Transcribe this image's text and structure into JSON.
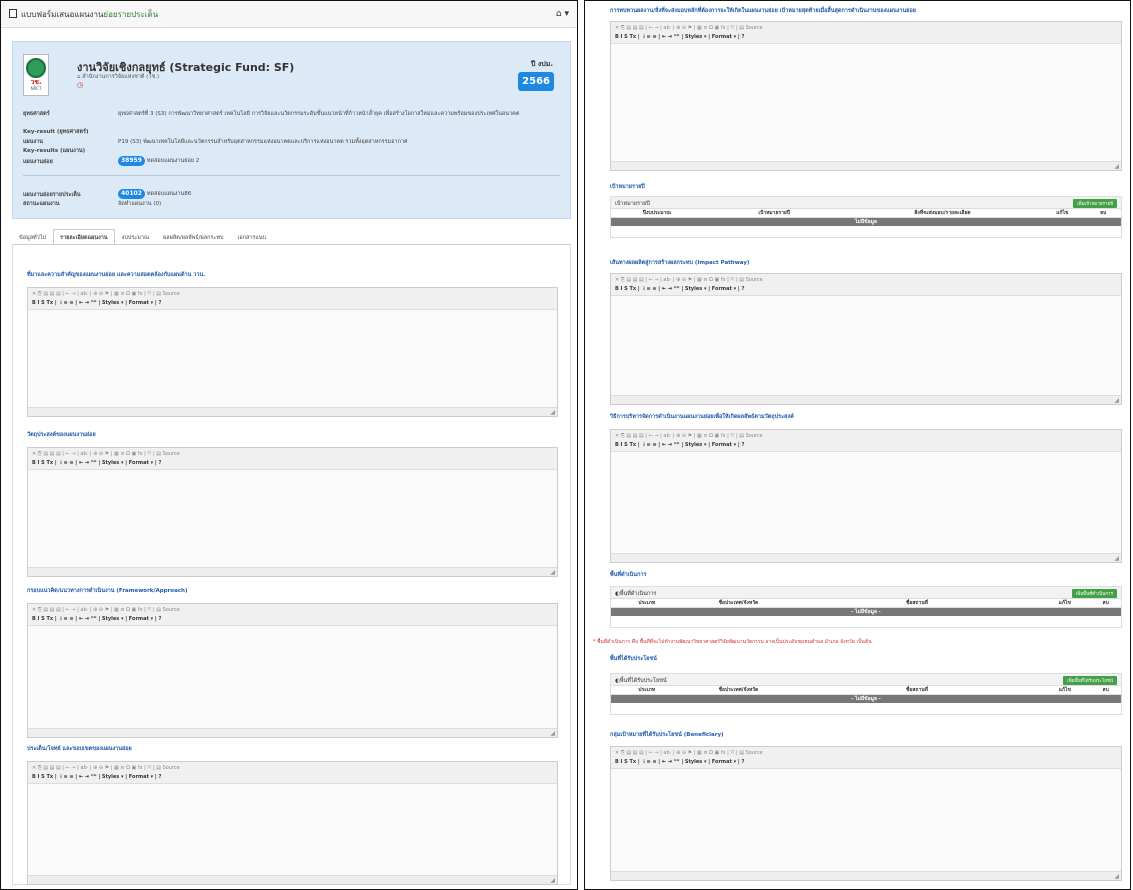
{
  "topbar": {
    "title_prefix": "แบบฟอร์มเสนอแผนงาน",
    "title_link": "ย่อยรายประเด็น",
    "home_icon": "home-icon"
  },
  "card": {
    "title": "งานวิจัยเชิงกลยุทธ์ (Strategic Fund: SF)",
    "agency": "สำนักงานการวิจัยแห่งชาติ (วช.)",
    "logo_text": "วช.",
    "logo_sub": "NRCT",
    "year_label": "ปี งปม.",
    "year": "2566",
    "rows": [
      {
        "label": "ยุทธศาสตร์",
        "value": "ยุทธศาสตร์ที่ 3 (S3) การพัฒนาวิทยาศาสตร์ เทคโนโลยี การวิจัยและนวัตกรรมระดับขั้นแนวหน้าที่ก้าวหน้าล้ำยุค เพื่อสร้างโอกาสใหม่และความพร้อมของประเทศในอนาคต"
      },
      {
        "label": "Key-result (ยุทธศาสตร์)",
        "value": ""
      },
      {
        "label": "แผนงาน",
        "value": "P19 (S3) พัฒนาเทคโนโลยีและนวัตกรรมสำหรับอุตสาหกรรมแห่งอนาคตและบริการแห่งอนาคต รวมทั้งอุตสาหกรรมอากาศ"
      },
      {
        "label": "Key-results (แผนงาน)",
        "value": ""
      },
      {
        "label": "แผนงานย่อย",
        "pill": "38959",
        "value": "ทดสอบแผนงานย่อย 2"
      },
      {
        "label": "แผนงานย่อยรายประเด็น",
        "pill": "40102",
        "value": "ทดสอบแผนงาน86"
      },
      {
        "label": "สถานะแผนงาน",
        "value": "จัดทำแผนงาน (0)"
      }
    ]
  },
  "tabs": [
    "ข้อมูลทั่วไป",
    "รายละเอียดแผนงาน",
    "งบประมาณ",
    "ผลผลิต/ผลลัพธ์/ผลกระทบ",
    "เอกสารแนบ"
  ],
  "editor_toolbar": {
    "row1": "✕ ⎘ ▤ ▤ ▤ | ← → | ab· | ⊕ ⊖ ⚑ | ▦ ≡ Ω ▣ fx | ⤧ | ▤ Source",
    "row2": "B  I  S  Tx | ⋮≡ ≡ | ⇤ ⇥ ❞❞ | Styles  ▾ | Format  ▾ | ?"
  },
  "left_sections": [
    "ที่มาและความสำคัญของแผนงานย่อย และความสอดคล้องกับแผนด้าน ววน.",
    "วัตถุประสงค์ของแผนงานย่อย",
    "กรอบแนวคิด/แนวทางการดำเนินงาน (Framework/Approach)",
    "ประเด็น/โจทย์ และขอบเขตของแผนงานย่อย"
  ],
  "right": {
    "sec_top": "การทบทวนผลงาน/สิ่งที่จะส่งมอบหลักที่ต้องการจะให้เกิดในแผนงานย่อย เป้าหมายสุดท้ายเมื่อสิ้นสุดการดำเนินงานของแผนงานย่อย",
    "sec_target": "เป้าหมายรายปี",
    "target_table": {
      "title": "เป้าหมายรายปี",
      "button": "เพิ่มเป้าหมายรายปี",
      "cols": [
        "ปีงบประมาณ",
        "เป้าหมายรายปี",
        "สิ่งที่จะส่งมอบ/รายละเอียด",
        "แก้ไข",
        "ลบ"
      ],
      "empty": "ไม่มีข้อมูล"
    },
    "sec_impact": "เส้นทางผลผลิตสู่การสร้างผลกระทบ (Impact Pathway)",
    "sec_manage": "วิธีการบริหารจัดการดำเนินงานแผนงานย่อยเพื่อให้เกิดผลลัพธ์ตามวัตถุประสงค์",
    "sec_area": "พื้นที่ดำเนินการ",
    "area_table": {
      "title": "พื้นที่ดำเนินการ",
      "button": "เพิ่มพื้นที่ดำเนินการ",
      "cols": [
        "ประเภท",
        "ชื่อประเทศ/จังหวัด",
        "ชื่อสถานที่",
        "แก้ไข",
        "ลบ"
      ],
      "empty": "- ไม่มีข้อมูล -"
    },
    "area_note": "* พื้นที่ดำเนินการ คือ พื้นที่ที่จะไปทำงานพัฒนาวิทยาศาสตร์วิจัยพัฒนานวัตกรรม อาจเป็นประดับชุมชนตำบล อำเภอ จังหวัด เป็นต้น",
    "sec_benefit": "พื้นที่ได้รับประโยชน์",
    "benefit_table": {
      "title": "พื้นที่ได้รับประโยชน์",
      "button": "เพิ่มพื้นที่ได้รับประโยชน์",
      "cols": [
        "ประเภท",
        "ชื่อประเทศ/จังหวัด",
        "ชื่อสถานที่",
        "แก้ไข",
        "ลบ"
      ],
      "empty": "- ไม่มีข้อมูล -"
    },
    "sec_beneficiary": "กลุ่มเป้าหมายที่ได้รับประโยชน์ (Beneficiary)"
  }
}
